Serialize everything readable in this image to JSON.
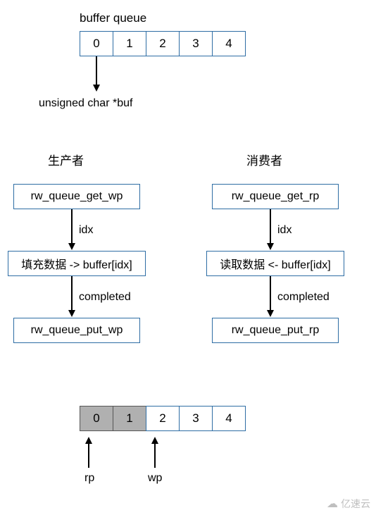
{
  "top": {
    "title": "buffer queue",
    "cells": [
      "0",
      "1",
      "2",
      "3",
      "4"
    ],
    "pointer_label": "unsigned char *buf"
  },
  "producer": {
    "heading": "生产者",
    "step1": "rw_queue_get_wp",
    "arrow1_label": "idx",
    "step2": "填充数据 -> buffer[idx]",
    "arrow2_label": "completed",
    "step3": "rw_queue_put_wp"
  },
  "consumer": {
    "heading": "消费者",
    "step1": "rw_queue_get_rp",
    "arrow1_label": "idx",
    "step2": "读取数据 <- buffer[idx]",
    "arrow2_label": "completed",
    "step3": "rw_queue_put_rp"
  },
  "bottom": {
    "cells": [
      "0",
      "1",
      "2",
      "3",
      "4"
    ],
    "filled_count": 2,
    "rp_label": "rp",
    "wp_label": "wp"
  },
  "watermark": "亿速云",
  "chart_data": {
    "type": "table",
    "title": "buffer queue diagram",
    "buffer_size": 5,
    "buffer_indices": [
      0,
      1,
      2,
      3,
      4
    ],
    "pointer_name": "unsigned char *buf",
    "producer_flow": [
      "rw_queue_get_wp",
      "idx",
      "填充数据 -> buffer[idx]",
      "completed",
      "rw_queue_put_wp"
    ],
    "consumer_flow": [
      "rw_queue_get_rp",
      "idx",
      "读取数据 <- buffer[idx]",
      "completed",
      "rw_queue_put_rp"
    ],
    "state_example": {
      "rp": 0,
      "wp": 2,
      "filled_slots": [
        0,
        1
      ]
    }
  }
}
